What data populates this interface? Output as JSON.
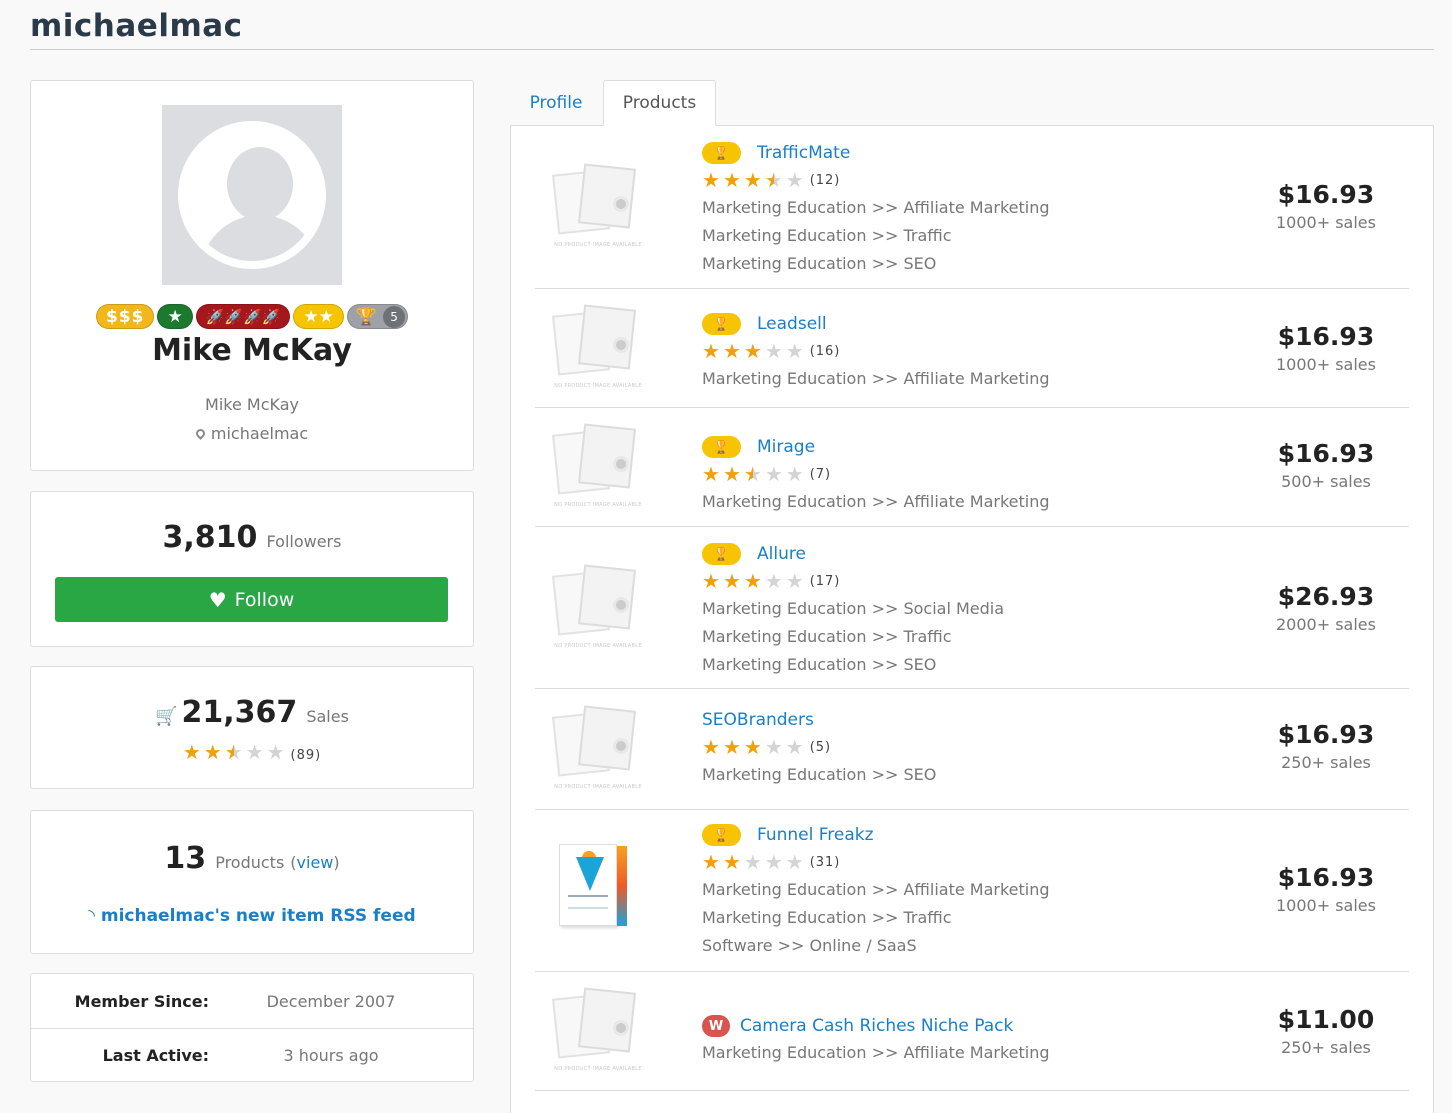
{
  "username": "michaelmac",
  "profile": {
    "name": "Mike McKay",
    "subname": "Mike McKay",
    "location": "michaelmac",
    "badges": {
      "dollar": "$$$",
      "star": "★",
      "rockets": "🚀🚀🚀🚀",
      "stars": "★★",
      "trophy_count": "5"
    }
  },
  "followers": {
    "count": "3,810",
    "label": "Followers",
    "follow_label": "Follow"
  },
  "sales": {
    "count": "21,367",
    "label": "Sales",
    "rating": 2.5,
    "reviews": "(89)"
  },
  "products_summary": {
    "count": "13",
    "label": "Products",
    "view_open": "(",
    "view_label": "view",
    "view_close": ")",
    "rss_label": "michaelmac's new item RSS feed"
  },
  "member": {
    "since_label": "Member Since:",
    "since_value": "December 2007",
    "active_label": "Last Active:",
    "active_value": "3 hours ago"
  },
  "tabs": {
    "profile": "Profile",
    "products": "Products"
  },
  "thumb_placeholder_text": "NO PRODUCT IMAGE AVAILABLE",
  "colors": {
    "link": "#1a7fc7",
    "follow": "#29a745",
    "star": "#f0a00b",
    "trophy": "#f6c400"
  },
  "products": [
    {
      "title": "TrafficMate",
      "badge": "trophy",
      "rating": 3.5,
      "reviews": "(12)",
      "categories": [
        "Marketing Education >> Affiliate Marketing",
        "Marketing Education >> Traffic",
        "Marketing Education >> SEO"
      ],
      "price": "$16.93",
      "sales": "1000+ sales",
      "image": "placeholder"
    },
    {
      "title": "Leadsell",
      "badge": "trophy",
      "rating": 3,
      "reviews": "(16)",
      "categories": [
        "Marketing Education >> Affiliate Marketing"
      ],
      "price": "$16.93",
      "sales": "1000+ sales",
      "image": "placeholder"
    },
    {
      "title": "Mirage",
      "badge": "trophy",
      "rating": 2.5,
      "reviews": "(7)",
      "categories": [
        "Marketing Education >> Affiliate Marketing"
      ],
      "price": "$16.93",
      "sales": "500+ sales",
      "image": "placeholder"
    },
    {
      "title": "Allure",
      "badge": "trophy",
      "rating": 3,
      "reviews": "(17)",
      "categories": [
        "Marketing Education >> Social Media",
        "Marketing Education >> Traffic",
        "Marketing Education >> SEO"
      ],
      "price": "$26.93",
      "sales": "2000+ sales",
      "image": "placeholder"
    },
    {
      "title": "SEOBranders",
      "badge": "none",
      "rating": 3,
      "reviews": "(5)",
      "categories": [
        "Marketing Education >> SEO"
      ],
      "price": "$16.93",
      "sales": "250+ sales",
      "image": "placeholder"
    },
    {
      "title": "Funnel Freakz",
      "badge": "trophy",
      "rating": 2,
      "reviews": "(31)",
      "categories": [
        "Marketing Education >> Affiliate Marketing",
        "Marketing Education >> Traffic",
        "Software >> Online / SaaS"
      ],
      "price": "$16.93",
      "sales": "1000+ sales",
      "image": "boxshot"
    },
    {
      "title": "Camera Cash Riches Niche Pack",
      "badge": "w",
      "badge_text": "W",
      "categories": [
        "Marketing Education >> Affiliate Marketing"
      ],
      "price": "$11.00",
      "sales": "250+ sales",
      "image": "placeholder"
    }
  ]
}
